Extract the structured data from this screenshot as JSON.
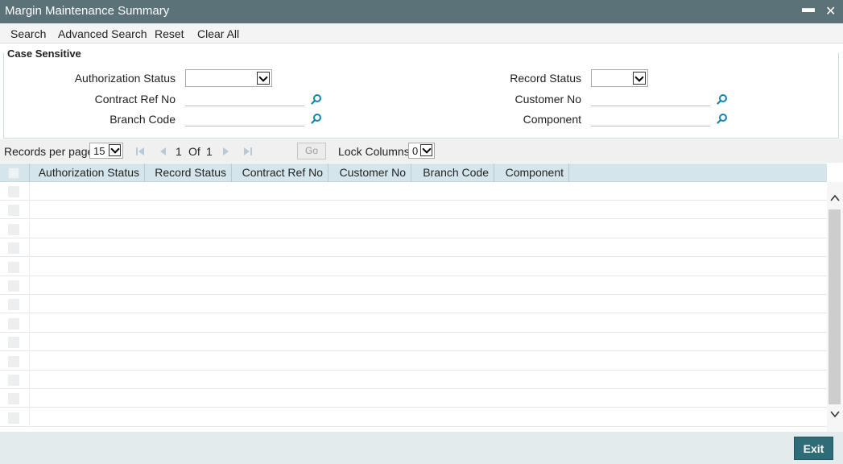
{
  "window": {
    "title": "Margin Maintenance Summary",
    "minimize_glyph": "▬",
    "close_glyph": "✕"
  },
  "toolbar": {
    "search": "Search",
    "advanced_search": "Advanced Search",
    "reset": "Reset",
    "clear_all": "Clear All"
  },
  "criteria": {
    "legend": "Case Sensitive",
    "authorization_status": {
      "label": "Authorization Status",
      "value": ""
    },
    "record_status": {
      "label": "Record Status",
      "value": ""
    },
    "contract_ref_no": {
      "label": "Contract Ref No",
      "value": ""
    },
    "customer_no": {
      "label": "Customer No",
      "value": ""
    },
    "branch_code": {
      "label": "Branch Code",
      "value": ""
    },
    "component": {
      "label": "Component",
      "value": ""
    }
  },
  "pager": {
    "records_per_page_label": "Records per page",
    "records_per_page": "15",
    "current_page": "1",
    "of_label": "Of",
    "total_pages": "1",
    "go_label": "Go",
    "lock_columns_label": "Lock Columns",
    "lock_columns": "0"
  },
  "grid": {
    "columns": [
      "Authorization Status",
      "Record Status",
      "Contract Ref No",
      "Customer No",
      "Branch Code",
      "Component"
    ],
    "empty_rows": 13
  },
  "footer": {
    "exit": "Exit"
  },
  "colors": {
    "titlebar": "#5a7278",
    "grid_header": "#d4e6ec",
    "exit_button": "#2e6d78",
    "lookup_icon": "#1a82a8"
  },
  "icons": {
    "lookup": "search-lookup-icon",
    "first": "first-page-icon",
    "prev": "previous-page-icon",
    "next": "next-page-icon",
    "last": "last-page-icon"
  }
}
